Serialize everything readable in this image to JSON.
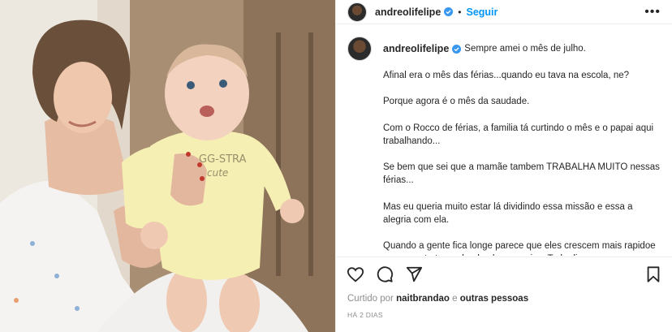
{
  "header": {
    "username": "andreolifelipe",
    "separator": "•",
    "follow_label": "Seguir",
    "more_label": "•••"
  },
  "caption": {
    "username": "andreolifelipe",
    "first_line": "Sempre amei o mês de julho.",
    "paragraphs": [
      "Afinal era o mês das férias...quando eu tava na escola, ne?",
      "Porque agora é o mês da saudade.",
      "Com o Rocco de férias, a familia tá curtindo o mês e o papai aqui trabalhando...",
      "Se bem que sei que a mamãe tambem TRABALHA MUITO nessas férias...",
      "Mas eu queria muito estar lá dividindo essa missão e essa a alegria com ela.",
      "Quando a gente fica longe parece que eles crescem mais rapidoe que a gente ta perdendo alguma coisa. Todo dia."
    ]
  },
  "likes": {
    "prefix": "Curtido por",
    "user": "naitbrandao",
    "conjunction": "e",
    "others": "outras pessoas"
  },
  "timestamp": "HÁ 2 DIAS",
  "icons": {
    "like": "heart-icon",
    "comment": "comment-icon",
    "share": "send-icon",
    "save": "bookmark-icon",
    "verified": "verified-badge-icon"
  },
  "colors": {
    "accent": "#0095f6",
    "verified": "#3897f0",
    "muted": "#8e8e8e",
    "text": "#262626"
  },
  "media": {
    "bodysuit_text_line1": "GG-STRA",
    "bodysuit_text_line2": "cute"
  }
}
